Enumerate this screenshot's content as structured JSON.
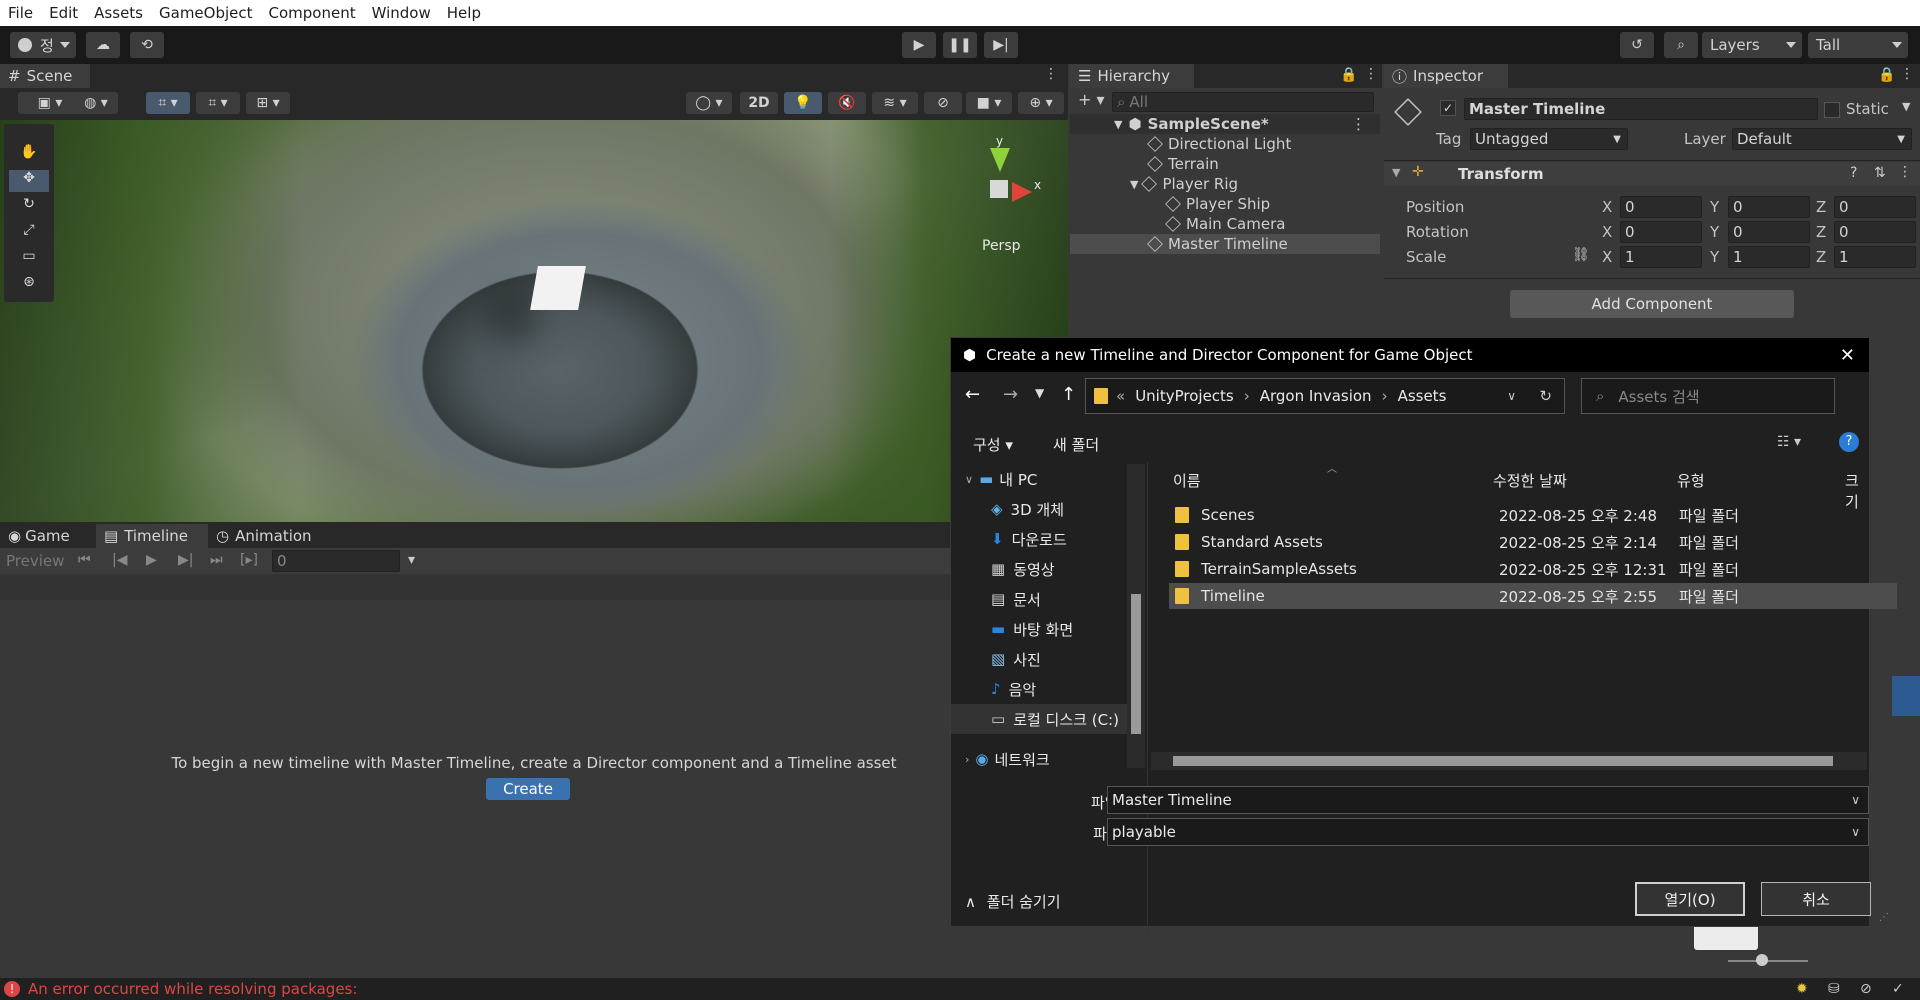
{
  "menu": [
    "File",
    "Edit",
    "Assets",
    "GameObject",
    "Component",
    "Window",
    "Help"
  ],
  "toolbar": {
    "account_label": "정",
    "layers_label": "Layers",
    "layout_label": "Tall"
  },
  "scene": {
    "tab_label": "Scene",
    "btn_2d": "2D",
    "persp_label": "Persp",
    "axis_x": "x",
    "axis_y": "y"
  },
  "bottom_tabs": [
    "Game",
    "Timeline",
    "Animation"
  ],
  "timeline": {
    "preview_label": "Preview",
    "frame_value": "0",
    "message": "To begin a new timeline with Master Timeline, create a Director component and a Timeline asset",
    "create_label": "Create"
  },
  "hierarchy": {
    "tab_label": "Hierarchy",
    "search_placeholder": "All",
    "items": [
      {
        "label": "SampleScene*"
      },
      {
        "label": "Directional Light"
      },
      {
        "label": "Terrain"
      },
      {
        "label": "Player Rig"
      },
      {
        "label": "Player Ship"
      },
      {
        "label": "Main Camera"
      },
      {
        "label": "Master Timeline"
      }
    ]
  },
  "inspector": {
    "tab_label": "Inspector",
    "object_name": "Master Timeline",
    "static_label": "Static",
    "tag_label": "Tag",
    "tag_value": "Untagged",
    "layer_label": "Layer",
    "layer_value": "Default",
    "transform_label": "Transform",
    "position_label": "Position",
    "rotation_label": "Rotation",
    "scale_label": "Scale",
    "x_label": "X",
    "y_label": "Y",
    "z_label": "Z",
    "position": [
      "0",
      "0",
      "0"
    ],
    "rotation": [
      "0",
      "0",
      "0"
    ],
    "scale": [
      "1",
      "1",
      "1"
    ],
    "add_component_label": "Add Component"
  },
  "dialog": {
    "title": "Create a new Timeline and Director Component for Game Object",
    "breadcrumb": [
      "UnityProjects",
      "Argon Invasion",
      "Assets"
    ],
    "breadcrumb_prefix": "«",
    "search_placeholder": "Assets 검색",
    "organize_label": "구성",
    "new_folder_label": "새 폴더",
    "nav_items": [
      "내 PC",
      "3D 개체",
      "다운로드",
      "동영상",
      "문서",
      "바탕 화면",
      "사진",
      "음악",
      "로컬 디스크 (C:)",
      "네트워크"
    ],
    "columns": [
      "이름",
      "수정한 날짜",
      "유형",
      "크기"
    ],
    "files": [
      {
        "name": "Scenes",
        "date": "2022-08-25 오후 2:48",
        "type": "파일 폴더"
      },
      {
        "name": "Standard Assets",
        "date": "2022-08-25 오후 2:14",
        "type": "파일 폴더"
      },
      {
        "name": "TerrainSampleAssets",
        "date": "2022-08-25 오후 12:31",
        "type": "파일 폴더"
      },
      {
        "name": "Timeline",
        "date": "2022-08-25 오후 2:55",
        "type": "파일 폴더"
      }
    ],
    "filename_label": "파일 이름(N):",
    "filename_value": "Master Timeline",
    "filetype_label": "파일 형식(T):",
    "filetype_value": "playable",
    "hide_folders_label": "폴더 숨기기",
    "open_label": "열기(O)",
    "cancel_label": "취소"
  },
  "status": {
    "error_text": "An error occurred while resolving packages:"
  },
  "colors": {
    "error": "#e04545",
    "accent": "#3a72b0",
    "selection": "#4d4d4d"
  }
}
